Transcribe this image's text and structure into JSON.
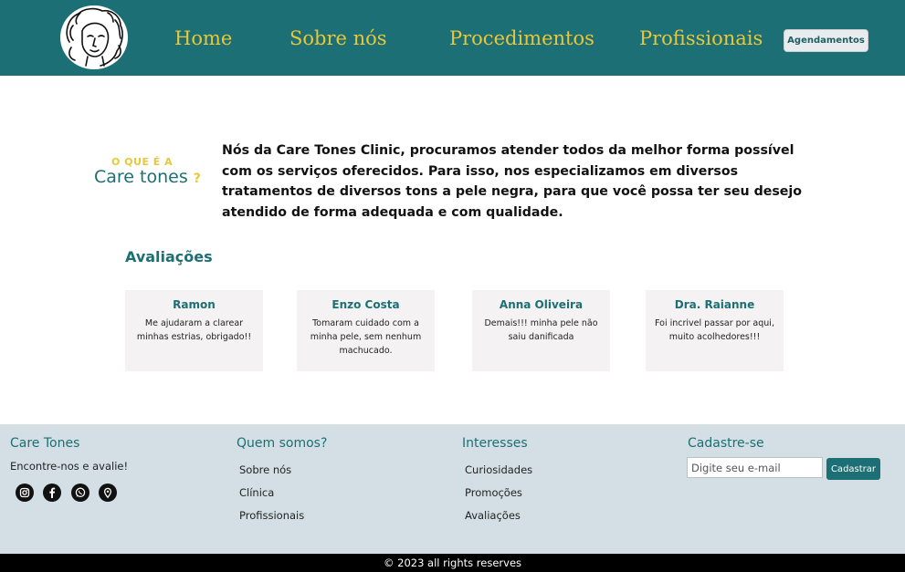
{
  "header": {
    "nav": [
      "Home",
      "Sobre nós",
      "Procedimentos",
      "Profissionais"
    ],
    "cta_label": "Agendamentos"
  },
  "about": {
    "kicker": "O QUE É A",
    "title": "Care tones",
    "title_mark": "?",
    "text": "Nós da Care Tones  Clinic, procuramos atender todos da melhor forma possível com os serviços oferecidos. Para isso, nos especializamos em  diversos tratamentos de diversos tons a pele negra, para que você possa ter seu desejo atendido de forma adequada e com qualidade."
  },
  "reviews": {
    "title": "Avaliações",
    "items": [
      {
        "name": "Ramon",
        "text": "Me ajudaram a clarear minhas estrias, obrigado!!"
      },
      {
        "name": "Enzo Costa",
        "text": "Tomaram cuidado com a minha pele, sem nenhum machucado."
      },
      {
        "name": "Anna Oliveira",
        "text": "Demais!!! minha pele não saiu danificada"
      },
      {
        "name": "Dra. Raianne",
        "text": "Foi incrivel passar por aqui, muito acolhedores!!!"
      }
    ]
  },
  "footer": {
    "brand": {
      "title": "Care Tones",
      "subtitle": "Encontre-nos e avalie!"
    },
    "social_icons": [
      "instagram-icon",
      "facebook-icon",
      "whatsapp-icon",
      "location-pin-icon"
    ],
    "col_about": {
      "title": "Quem somos?",
      "links": [
        "Sobre nós",
        "Clínica",
        "Profissionais"
      ]
    },
    "col_interests": {
      "title": "Interesses",
      "links": [
        "Curiosidades",
        "Promoções",
        "Avaliações"
      ]
    },
    "signup": {
      "title": "Cadastre-se",
      "placeholder": "Digite seu e-mail",
      "button": "Cadastrar"
    }
  },
  "copyright": "© 2023 all rights reserves",
  "colors": {
    "primary": "#1c6f74",
    "accent": "#e8c73a",
    "footer_bg": "#d3dfe4",
    "card_bg": "#f4f2f2"
  }
}
